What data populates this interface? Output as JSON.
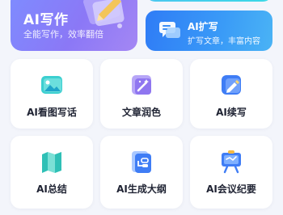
{
  "featured": {
    "write": {
      "title": "AI写作",
      "subtitle": "全能写作，效率翻倍",
      "icon": "pen-illustration-icon"
    },
    "expand": {
      "title": "AI扩写",
      "subtitle": "扩写文章，丰富内容",
      "icon": "chat-bubbles-icon"
    }
  },
  "tools": [
    {
      "label": "AI看图写话",
      "icon": "image-icon"
    },
    {
      "label": "文章润色",
      "icon": "magic-wand-icon"
    },
    {
      "label": "AI续写",
      "icon": "pen-continue-icon"
    },
    {
      "label": "AI总结",
      "icon": "map-summary-icon"
    },
    {
      "label": "AI生成大纲",
      "icon": "outline-icon"
    },
    {
      "label": "AI会议纪要",
      "icon": "meeting-board-icon"
    }
  ],
  "colors": {
    "write_card": "#8b78f6",
    "expand_card": "#3a9bf7",
    "accent_blue": "#3f7df5",
    "accent_teal": "#33c9c2"
  }
}
